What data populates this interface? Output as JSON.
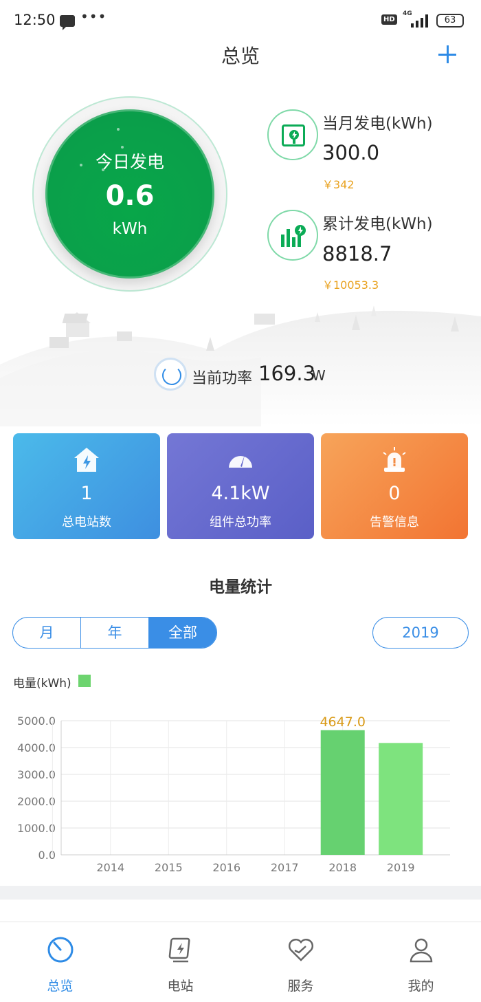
{
  "status_bar": {
    "time": "12:50",
    "dots": "•••",
    "hd": "HD",
    "network": "4G",
    "battery": "63"
  },
  "header": {
    "title": "总览",
    "add_icon": "plus-icon"
  },
  "today": {
    "label": "今日发电",
    "value": "0.6",
    "unit": "kWh"
  },
  "monthly": {
    "title": "当月发电(kWh)",
    "value": "300.0",
    "money": "￥342",
    "icon": "solar-panel-icon"
  },
  "total": {
    "title": "累计发电(kWh)",
    "value": "8818.7",
    "money": "￥10053.3",
    "icon": "bar-chart-icon"
  },
  "current_power": {
    "label": "当前功率",
    "value": "169.3",
    "unit": "W"
  },
  "tiles": [
    {
      "value": "1",
      "label": "总电站数",
      "icon": "home-bolt-icon"
    },
    {
      "value": "4.1kW",
      "label": "组件总功率",
      "icon": "gauge-icon"
    },
    {
      "value": "0",
      "label": "告警信息",
      "icon": "alarm-icon"
    }
  ],
  "stats_section": {
    "title": "电量统计",
    "tabs": [
      "月",
      "年",
      "全部"
    ],
    "active_tab": "全部",
    "year": "2019",
    "legend": "电量(kWh)"
  },
  "chart_data": {
    "type": "bar",
    "categories": [
      "2014",
      "2015",
      "2016",
      "2017",
      "2018",
      "2019"
    ],
    "values": [
      0,
      0,
      0,
      0,
      4647.0,
      4171.0
    ],
    "ylabel": "电量(kWh)",
    "ylim": [
      0,
      5000
    ],
    "yticks": [
      "0.0",
      "1000.0",
      "2000.0",
      "3000.0",
      "4000.0",
      "5000.0"
    ],
    "highlight_label": "4647.0",
    "colors": {
      "bar_2018": "#66d170",
      "bar_2019": "#7ee37e",
      "highlight": "#d99a16"
    }
  },
  "bottom_nav": [
    {
      "label": "总览",
      "icon": "overview-dial-icon",
      "active": true
    },
    {
      "label": "电站",
      "icon": "station-icon",
      "active": false
    },
    {
      "label": "服务",
      "icon": "service-heart-icon",
      "active": false
    },
    {
      "label": "我的",
      "icon": "profile-icon",
      "active": false
    }
  ],
  "colors": {
    "accent": "#2e8be6",
    "green": "#0aa04a",
    "money": "#e9a21f"
  }
}
